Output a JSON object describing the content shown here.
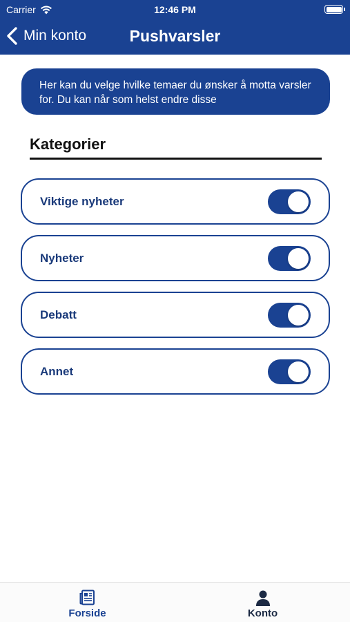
{
  "status_bar": {
    "carrier": "Carrier",
    "time": "12:46 PM",
    "wifi_icon": "wifi-icon",
    "battery_icon": "battery-icon"
  },
  "nav": {
    "back_label": "Min konto",
    "title": "Pushvarsler",
    "back_icon": "chevron-left-icon"
  },
  "info_text": "Her kan du velge hvilke temaer du ønsker å motta varsler for. Du kan når som helst endre disse",
  "section_title": "Kategorier",
  "categories": [
    {
      "label": "Viktige nyheter",
      "enabled": true
    },
    {
      "label": "Nyheter",
      "enabled": true
    },
    {
      "label": "Debatt",
      "enabled": true
    },
    {
      "label": "Annet",
      "enabled": true
    }
  ],
  "tab_bar": {
    "tabs": [
      {
        "label": "Forside",
        "icon": "newspaper-icon"
      },
      {
        "label": "Konto",
        "icon": "person-icon"
      }
    ]
  },
  "colors": {
    "brand": "#1a4292",
    "label_text": "#1a3a7a",
    "background": "#ffffff"
  }
}
